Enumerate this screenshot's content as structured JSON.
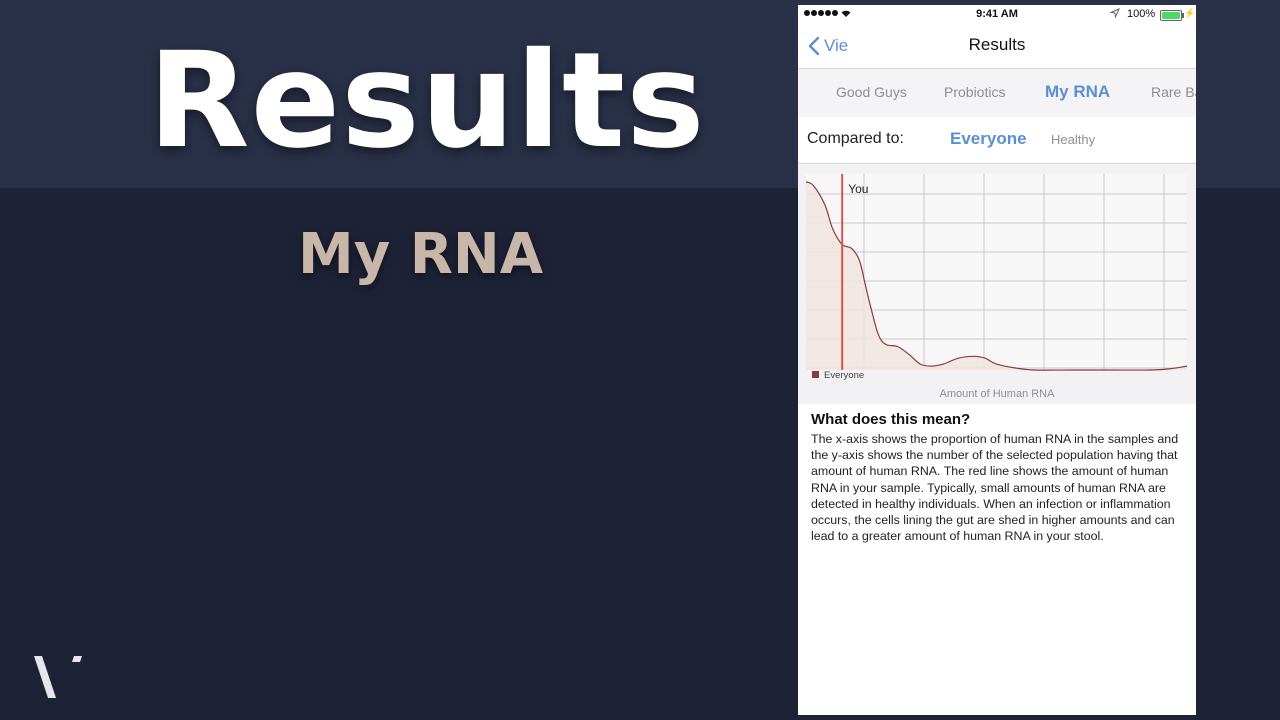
{
  "slide": {
    "title": "Results",
    "subtitle": "My RNA",
    "logo_icon": "v-logo-icon"
  },
  "phone": {
    "status": {
      "time": "9:41 AM",
      "battery": "100%",
      "icons": [
        "signal-dots-icon",
        "wifi-icon",
        "location-arrow-icon",
        "battery-icon",
        "charging-bolt-icon"
      ]
    },
    "nav": {
      "back_label": "Vie",
      "title": "Results"
    },
    "tabs": [
      {
        "label": "Good Guys",
        "active": false
      },
      {
        "label": "Probiotics",
        "active": false
      },
      {
        "label": "My RNA",
        "active": true
      },
      {
        "label": "Rare Ba",
        "active": false
      }
    ],
    "compare": {
      "label": "Compared to:",
      "options": [
        {
          "label": "Everyone",
          "selected": true
        },
        {
          "label": "Healthy",
          "selected": false
        }
      ]
    },
    "info": {
      "title": "What does this mean?",
      "body": "The x-axis shows the proportion of human RNA in the samples and the y-axis shows the number of the selected population having that amount of human RNA. The red line shows the amount of human RNA in your sample. Typically, small amounts of human RNA are detected in healthy individuals. When an infection or inflammation occurs, the cells lining the gut are shed in higher amounts and can lead to a greater amount of human RNA in your stool."
    }
  },
  "chart_data": {
    "type": "area",
    "xlabel": "Amount of Human RNA",
    "ylabel": "",
    "xlim": [
      0,
      1
    ],
    "ylim": [
      0,
      1
    ],
    "grid": true,
    "legend": "bottom-left",
    "marker": {
      "label": "You",
      "x": 0.095,
      "color": "#d9534f"
    },
    "series": [
      {
        "name": "Everyone",
        "color": "#8b3a3a",
        "fill": "#f0e4df",
        "x": [
          0,
          0.02,
          0.05,
          0.07,
          0.095,
          0.12,
          0.14,
          0.155,
          0.17,
          0.19,
          0.21,
          0.24,
          0.27,
          0.3,
          0.33,
          0.36,
          0.4,
          0.44,
          0.47,
          0.5,
          0.55,
          0.6,
          0.7,
          0.8,
          0.9,
          0.95,
          1.0
        ],
        "y": [
          0.96,
          0.94,
          0.84,
          0.72,
          0.64,
          0.62,
          0.56,
          0.44,
          0.32,
          0.18,
          0.13,
          0.12,
          0.08,
          0.03,
          0.02,
          0.03,
          0.06,
          0.07,
          0.06,
          0.03,
          0.01,
          0.0,
          0.0,
          0.0,
          0.0,
          0.005,
          0.02
        ]
      }
    ]
  }
}
